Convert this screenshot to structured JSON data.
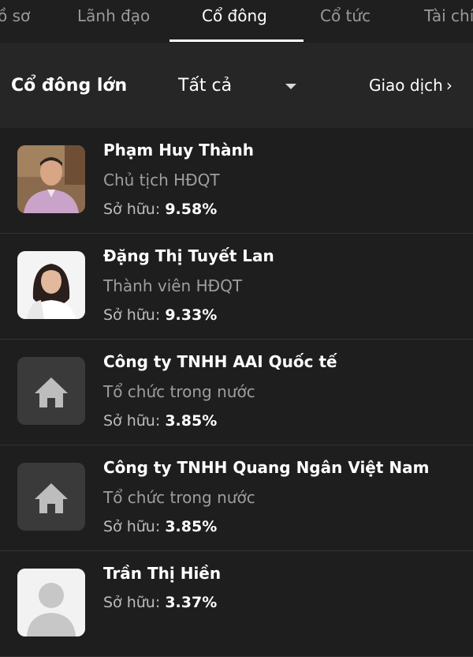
{
  "tabs": [
    {
      "label": "Hồ sơ"
    },
    {
      "label": "Lãnh đạo"
    },
    {
      "label": "Cổ đông"
    },
    {
      "label": "Cổ tức"
    },
    {
      "label": "Tài chính"
    }
  ],
  "header": {
    "title": "Cổ đông lớn",
    "filter_value": "Tất cả",
    "trade_link": "Giao dịch"
  },
  "ownership_label": "Sở hữu:",
  "shareholders": [
    {
      "name": "Phạm Huy Thành",
      "role": "Chủ tịch HĐQT",
      "ownership": "9.58%",
      "avatar": "photo-man"
    },
    {
      "name": "Đặng Thị Tuyết Lan",
      "role": "Thành viên HĐQT",
      "ownership": "9.33%",
      "avatar": "photo-woman"
    },
    {
      "name": "Công ty TNHH AAI Quốc tế",
      "role": "Tổ chức trong nước",
      "ownership": "3.85%",
      "avatar": "home-icon"
    },
    {
      "name": "Công ty TNHH Quang Ngân Việt Nam",
      "role": "Tổ chức trong nước",
      "ownership": "3.85%",
      "avatar": "home-icon"
    },
    {
      "name": "Trần Thị Hiền",
      "role": "",
      "ownership": "3.37%",
      "avatar": "person-placeholder-icon"
    }
  ],
  "colors": {
    "background": "#1e1e1e",
    "header_bg": "#262626",
    "active_tab": "#ffffff",
    "inactive_tab": "#9a9a9a",
    "secondary_text": "#9e9e9e"
  }
}
